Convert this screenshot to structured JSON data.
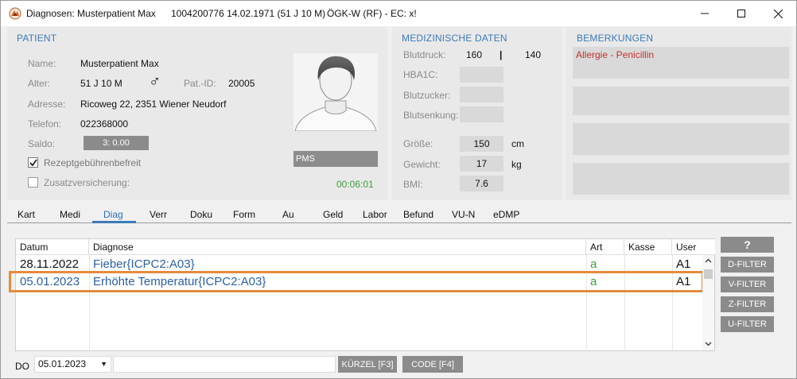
{
  "window": {
    "title": "Diagnosen: Musterpatient Max",
    "patient_ids": "1004200776 14.02.1971 (51 J 10 M)",
    "insurance": "ÖGK-W (RF) - EC: x!"
  },
  "patient": {
    "section_title": "PATIENT",
    "name_label": "Name:",
    "name": "Musterpatient Max",
    "age_label": "Alter:",
    "age": "51 J 10 M",
    "gender_symbol": "♂",
    "patid_label": "Pat.-ID:",
    "patid": "20005",
    "address_label": "Adresse:",
    "address": "Ricoweg 22, 2351 Wiener Neudorf",
    "phone_label": "Telefon:",
    "phone": "022368000",
    "saldo_label": "Saldo:",
    "saldo": "3: 0.00",
    "rezept_label": "Rezeptgebührenbefreit",
    "rezept_checked": true,
    "zusatz_label": "Zusatzversicherung:",
    "zusatz_checked": false,
    "pms": "PMS",
    "timer": "00:06:01"
  },
  "medical": {
    "section_title": "MEDIZINISCHE DATEN",
    "blutdruck_label": "Blutdruck:",
    "bp_sys": "160",
    "bp_sep": "|",
    "bp_dia": "140",
    "hba1c_label": "HBA1C:",
    "blutzucker_label": "Blutzucker:",
    "blutsenkung_label": "Blutsenkung:",
    "groesse_label": "Größe:",
    "groesse": "150",
    "groesse_unit": "cm",
    "gewicht_label": "Gewicht:",
    "gewicht": "17",
    "gewicht_unit": "kg",
    "bmi_label": "BMI:",
    "bmi": "7.6"
  },
  "remarks": {
    "section_title": "BEMERKUNGEN",
    "items": [
      "Allergie - Penicillin",
      "",
      "",
      ""
    ]
  },
  "tabs": [
    "Kart",
    "Medi",
    "Diag",
    "Verr",
    "Doku",
    "Form",
    "Au",
    "Geld",
    "Labor",
    "Befund",
    "VU-N",
    "eDMP"
  ],
  "active_tab": "Diag",
  "table": {
    "headers": {
      "datum": "Datum",
      "diagnose": "Diagnose",
      "art": "Art",
      "kasse": "Kasse",
      "user": "User"
    },
    "rows": [
      {
        "datum": "28.11.2022",
        "diagnose": "Fieber{ICPC2:A03}",
        "art": "a",
        "kasse": "",
        "user": "A1"
      },
      {
        "datum": "05.01.2023",
        "diagnose": "Erhöhte Temperatur{ICPC2:A03}",
        "art": "a",
        "kasse": "",
        "user": "A1"
      }
    ]
  },
  "filters": {
    "help": "?",
    "d": "D-FILTER",
    "v": "V-FILTER",
    "z": "Z-FILTER",
    "u": "U-FILTER"
  },
  "bottom": {
    "do_label": "DO",
    "date": "05.01.2023",
    "input_value": "",
    "kuerzel_button": "KÜRZEL [F3]",
    "code_button": "CODE [F4]"
  },
  "colors": {
    "accent": "#3c7ab8",
    "highlight": "#e58b3d",
    "remark": "#c0322c",
    "art": "#3aa13a"
  }
}
